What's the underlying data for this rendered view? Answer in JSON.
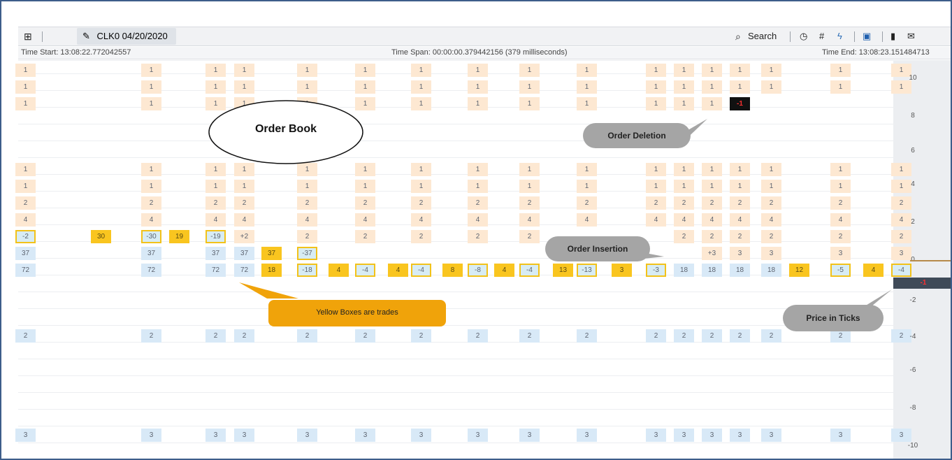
{
  "toolbar": {
    "tab_label": "CLK0 04/20/2020",
    "search_label": "Search",
    "icons": [
      "tree-icon",
      "pencil-icon",
      "search-icon",
      "clock-icon",
      "hash-icon",
      "lightning-icon",
      "save-icon",
      "bookmark-icon",
      "mail-icon"
    ]
  },
  "timebar": {
    "start": "Time Start: 13:08:22.772042557",
    "span": "Time Span: 00:00:00.379442156 (379 milliseconds)",
    "end": "Time End: 13:08:23.151484713"
  },
  "price_axis": {
    "labels": [
      "10",
      "8",
      "6",
      "4",
      "2",
      "0",
      "-1",
      "-2",
      "-4",
      "-6",
      "-8",
      "-10"
    ],
    "current_price": "-1"
  },
  "annotations": {
    "order_book": "Order Book",
    "order_deletion": "Order Deletion",
    "order_insertion": "Order Insertion",
    "trades": "Yellow Boxes are trades",
    "price_in_ticks": "Price in Ticks"
  },
  "colors": {
    "ask": "#fde8d2",
    "bid": "#d8e9f7",
    "trade": "#f9c51f",
    "callout_gray": "#a5a5a5",
    "callout_orange": "#f0a30a",
    "frame": "#3d5d8a"
  },
  "ladder": {
    "columns": 29,
    "rows": [
      {
        "price": "10",
        "cells": [
          "1",
          "",
          "1",
          "",
          "1",
          "1",
          "",
          "1",
          "",
          "1",
          "",
          "1",
          "",
          "1",
          "",
          "1",
          "",
          "1",
          "",
          "1",
          "1",
          "1",
          "1",
          "1",
          "",
          "1",
          "",
          "1"
        ]
      },
      {
        "price": "9",
        "cells": [
          "1",
          "",
          "1",
          "",
          "1",
          "1",
          "",
          "1",
          "",
          "1",
          "",
          "1",
          "",
          "1",
          "",
          "1",
          "",
          "1",
          "",
          "1",
          "1",
          "1",
          "1",
          "1",
          "",
          "1",
          "",
          "1"
        ]
      },
      {
        "price": "8",
        "cells": [
          "1",
          "",
          "1",
          "",
          "1",
          "1",
          "",
          "1",
          "",
          "1",
          "",
          "1",
          "",
          "1",
          "",
          "1",
          "",
          "1",
          "",
          "1",
          "1",
          "1",
          "-1",
          "",
          "",
          "",
          "",
          ""
        ]
      },
      {
        "price": "5",
        "cells": [
          "1",
          "",
          "1",
          "",
          "1",
          "1",
          "",
          "1",
          "",
          "1",
          "",
          "1",
          "",
          "1",
          "",
          "1",
          "",
          "1",
          "",
          "1",
          "1",
          "1",
          "1",
          "1",
          "",
          "1",
          "",
          "1"
        ]
      },
      {
        "price": "4",
        "cells": [
          "1",
          "",
          "1",
          "",
          "1",
          "1",
          "",
          "1",
          "",
          "1",
          "",
          "1",
          "",
          "1",
          "",
          "1",
          "",
          "1",
          "",
          "1",
          "1",
          "1",
          "1",
          "1",
          "",
          "1",
          "",
          "1"
        ]
      },
      {
        "price": "3",
        "cells": [
          "2",
          "",
          "2",
          "",
          "2",
          "2",
          "",
          "2",
          "",
          "2",
          "",
          "2",
          "",
          "2",
          "",
          "2",
          "",
          "2",
          "",
          "2",
          "2",
          "2",
          "2",
          "2",
          "",
          "2",
          "",
          "2"
        ]
      },
      {
        "price": "2",
        "cells": [
          "4",
          "",
          "4",
          "",
          "4",
          "4",
          "",
          "4",
          "",
          "4",
          "",
          "4",
          "",
          "4",
          "",
          "4",
          "",
          "4",
          "",
          "4",
          "4",
          "4",
          "4",
          "4",
          "",
          "4",
          "",
          "4"
        ]
      },
      {
        "price": "1",
        "cells": [
          "-2",
          "30",
          "-30",
          "19",
          "-19",
          "+2",
          "",
          "2",
          "",
          "2",
          "",
          "2",
          "",
          "2",
          "",
          "2",
          "",
          "",
          "",
          "",
          "2",
          "2",
          "2",
          "2",
          "",
          "2",
          "",
          "2"
        ]
      },
      {
        "price": "0",
        "cells": [
          "37",
          "",
          "37",
          "",
          "37",
          "37",
          "37",
          "-37",
          "",
          "",
          "",
          "",
          "",
          "",
          "",
          "",
          "",
          "",
          "",
          "",
          "",
          "+3",
          "3",
          "3",
          "",
          "3",
          "",
          "3"
        ]
      },
      {
        "price": "-1",
        "cells": [
          "72",
          "",
          "72",
          "",
          "72",
          "72",
          "18",
          "-18",
          "4",
          "-4",
          "4",
          "-4",
          "8",
          "-8",
          "4",
          "-4",
          "13",
          "-13",
          "3",
          "-3",
          "18",
          "18",
          "18",
          "18",
          "12",
          "-5",
          "4",
          "-4"
        ]
      },
      {
        "price": "-4",
        "cells": [
          "2",
          "",
          "2",
          "",
          "2",
          "2",
          "",
          "2",
          "",
          "2",
          "",
          "2",
          "",
          "2",
          "",
          "2",
          "",
          "2",
          "",
          "2",
          "2",
          "2",
          "2",
          "2",
          "",
          "2",
          "",
          "2"
        ]
      },
      {
        "price": "-10",
        "cells": [
          "3",
          "",
          "3",
          "",
          "3",
          "3",
          "",
          "3",
          "",
          "3",
          "",
          "3",
          "",
          "3",
          "",
          "3",
          "",
          "3",
          "",
          "3",
          "3",
          "3",
          "3",
          "3",
          "",
          "3",
          "",
          "3"
        ]
      }
    ]
  }
}
